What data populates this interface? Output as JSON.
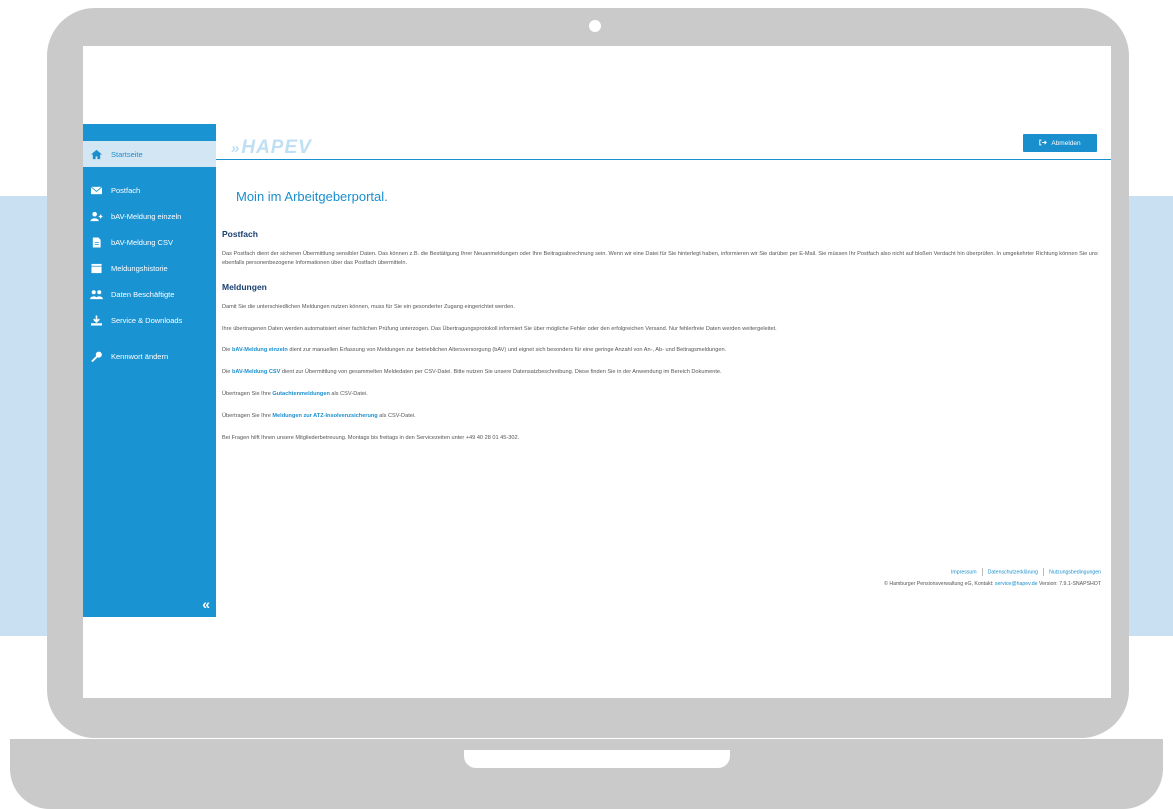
{
  "sidebar": {
    "items": [
      {
        "label": "Startseite",
        "icon": "home-icon"
      },
      {
        "label": "Postfach",
        "icon": "mail-icon"
      },
      {
        "label": "bAV-Meldung einzeln",
        "icon": "add-user-icon"
      },
      {
        "label": "bAV-Meldung CSV",
        "icon": "file-icon"
      },
      {
        "label": "Meldungshistorie",
        "icon": "history-icon"
      },
      {
        "label": "Daten Beschäftigte",
        "icon": "users-icon"
      },
      {
        "label": "Service & Downloads",
        "icon": "download-icon"
      },
      {
        "label": "Kennwort ändern",
        "icon": "key-icon"
      }
    ],
    "collapse_label": "«"
  },
  "header": {
    "logo_text": "HAPEV",
    "logout_label": "Abmelden"
  },
  "main": {
    "title": "Moin im Arbeitgeberportal.",
    "postfach": {
      "heading": "Postfach",
      "text": "Das Postfach dient der sicheren Übermittlung sensibler Daten. Das können z.B. die Bestätigung Ihrer Neuanmeldungen oder Ihre Beitragsabrechnung sein. Wenn wir eine Datei für Sie hinterlegt haben, informieren wir Sie darüber per E-Mail. Sie müssen Ihr Postfach also nicht auf bloßen Verdacht hin überprüfen. In umgekehrter Richtung können Sie uns ebenfalls personenbezogene Informationen über das Postfach übermitteln."
    },
    "meldungen": {
      "heading": "Meldungen",
      "p1": "Damit Sie die unterschiedlichen Meldungen nutzen können, muss für Sie ein gesonderter Zugang eingerichtet werden.",
      "p2": "Ihre übertragenen Daten werden automatisiert einer fachlichen Prüfung unterzogen. Das Übertragungsprotokoll informiert Sie über mögliche Fehler oder den erfolgreichen Versand. Nur fehlerfreie Daten werden weitergeleitet.",
      "p3_pre": "Die ",
      "p3_link": "bAV-Meldung einzeln",
      "p3_post": " dient zur manuellen Erfassung von Meldungen zur betrieblichen Altersversorgung (bAV) und eignet sich besonders für eine geringe Anzahl von An-, Ab- und Beitragsmeldungen.",
      "p4_pre": "Die ",
      "p4_link": "bAV-Meldung CSV",
      "p4_post": " dient zur Übermittlung von gesammelten Meldedaten per CSV-Datei. Bitte nutzen Sie unsere Datensatzbeschreibung. Diese finden Sie in der Anwendung im Bereich Dokumente.",
      "p5_pre": "Übertragen Sie Ihre ",
      "p5_link": "Gutachtenmeldungen",
      "p5_post": " als CSV-Datei.",
      "p6_pre": "Übertragen Sie Ihre ",
      "p6_link": "Meldungen zur ATZ-Insolvenzsicherung",
      "p6_post": " als CSV-Datei.",
      "p7": "Bei Fragen hilft Ihnen unsere Mitgliederbetreuung. Montags bis freitags in den Servicezeiten unter +49 40 28 01 45-302."
    }
  },
  "footer": {
    "links": [
      "Impressum",
      "Datenschutzerklärung",
      "Nutzungsbedingungen"
    ],
    "copy_pre": "© Hamburger Pensionsverwaltung eG, Kontakt: ",
    "copy_email": "service@hapev.de",
    "copy_post": " Version: 7.9.1-SNAPSHOT"
  },
  "colors": {
    "accent": "#1a8fce",
    "sidebar": "#1a93d3",
    "heading": "#1a3f6e"
  }
}
